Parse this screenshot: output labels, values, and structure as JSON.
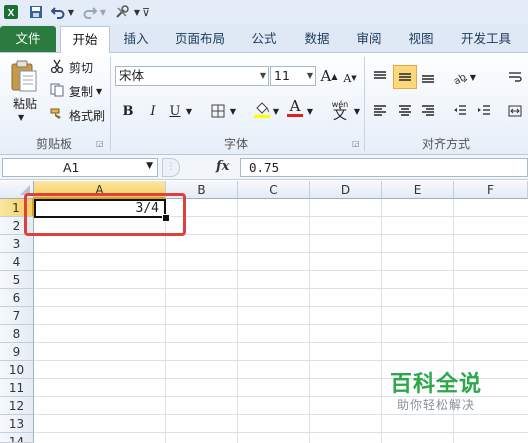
{
  "ribbon_tabs": [
    "文件",
    "开始",
    "插入",
    "页面布局",
    "公式",
    "数据",
    "审阅",
    "视图",
    "开发工具"
  ],
  "clipboard": {
    "paste": "粘贴",
    "cut": "剪切",
    "copy": "复制",
    "format_painter": "格式刷",
    "group_label": "剪贴板"
  },
  "font": {
    "name": "宋体",
    "size": "11",
    "grow": "A",
    "shrink": "A",
    "bold": "B",
    "italic": "I",
    "underline": "U",
    "phonetic": "wén",
    "phonetic_char": "文",
    "font_color_glyph": "A",
    "group_label": "字体"
  },
  "alignment": {
    "group_label": "对齐方式"
  },
  "formula_bar": {
    "name_box": "A1",
    "fx": "fx",
    "value": "0.75"
  },
  "sheet": {
    "columns": [
      "A",
      "B",
      "C",
      "D",
      "E",
      "F"
    ],
    "rows": [
      "1",
      "2",
      "3",
      "4",
      "5",
      "6",
      "7",
      "8",
      "9",
      "10",
      "11",
      "12",
      "13",
      "14"
    ],
    "active_cell": "A1",
    "a1_display": "3/4"
  },
  "watermark": {
    "title": "百科全说",
    "subtitle": "助你轻松解决"
  },
  "colors": {
    "file_tab": "#2b7a3f",
    "highlight_box": "#e0403b",
    "watermark_green": "#2aa84a",
    "selected_col_header": "#f7d97c"
  }
}
